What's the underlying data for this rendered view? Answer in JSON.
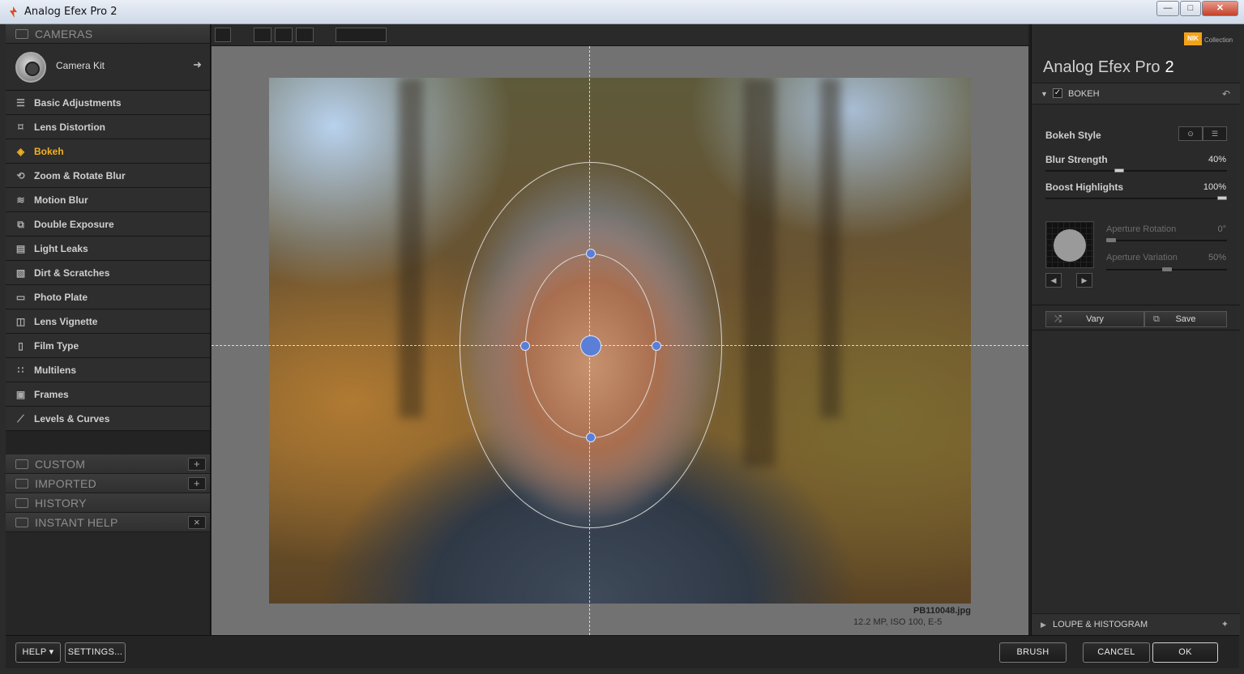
{
  "window": {
    "title": "Analog Efex Pro 2",
    "minimize_glyph": "—",
    "maximize_glyph": "□",
    "close_glyph": "✕"
  },
  "left_panel": {
    "cameras_header": "CAMERAS",
    "camera_kit_label": "Camera Kit",
    "filters": [
      {
        "label": "Basic Adjustments",
        "icon": "sliders-icon"
      },
      {
        "label": "Lens Distortion",
        "icon": "lens-distortion-icon"
      },
      {
        "label": "Bokeh",
        "icon": "bokeh-eye-icon",
        "active": true
      },
      {
        "label": "Zoom & Rotate Blur",
        "icon": "rotate-blur-icon"
      },
      {
        "label": "Motion Blur",
        "icon": "motion-blur-icon"
      },
      {
        "label": "Double Exposure",
        "icon": "double-exposure-icon"
      },
      {
        "label": "Light Leaks",
        "icon": "light-leaks-icon"
      },
      {
        "label": "Dirt & Scratches",
        "icon": "dirt-scratches-icon"
      },
      {
        "label": "Photo Plate",
        "icon": "photo-plate-icon"
      },
      {
        "label": "Lens Vignette",
        "icon": "lens-vignette-icon"
      },
      {
        "label": "Film Type",
        "icon": "film-type-icon"
      },
      {
        "label": "Multilens",
        "icon": "multilens-icon"
      },
      {
        "label": "Frames",
        "icon": "frames-icon"
      },
      {
        "label": "Levels & Curves",
        "icon": "levels-curves-icon"
      }
    ],
    "sections": {
      "custom": "CUSTOM",
      "imported": "IMPORTED",
      "history": "HISTORY",
      "instant_help": "INSTANT HELP"
    }
  },
  "image": {
    "filename": "PB110048.jpg",
    "meta": "12.2 MP, ISO 100, E-5"
  },
  "right_panel": {
    "brand_badge": "NIK",
    "brand_sub": "Collection",
    "product_name": "Analog Efex Pro",
    "product_version": "2",
    "filter_header": "BOKEH",
    "bokeh_style_label": "Bokeh Style",
    "blur_strength": {
      "label": "Blur Strength",
      "value": "40%",
      "fraction": 0.4
    },
    "boost_highlights": {
      "label": "Boost Highlights",
      "value": "100%",
      "fraction": 1.0
    },
    "aperture_rotation": {
      "label": "Aperture Rotation",
      "value": "0°",
      "fraction": 0.0
    },
    "aperture_variation": {
      "label": "Aperture Variation",
      "value": "50%",
      "fraction": 0.5
    },
    "vary_label": "Vary",
    "save_label": "Save",
    "loupe_header": "LOUPE & HISTOGRAM"
  },
  "bottom_bar": {
    "help_label": "HELP ▾",
    "settings_label": "SETTINGS...",
    "brush_label": "BRUSH",
    "cancel_label": "CANCEL",
    "ok_label": "OK"
  },
  "colors": {
    "active_accent": "#f2b123",
    "handle_blue": "#5b7fd6"
  }
}
